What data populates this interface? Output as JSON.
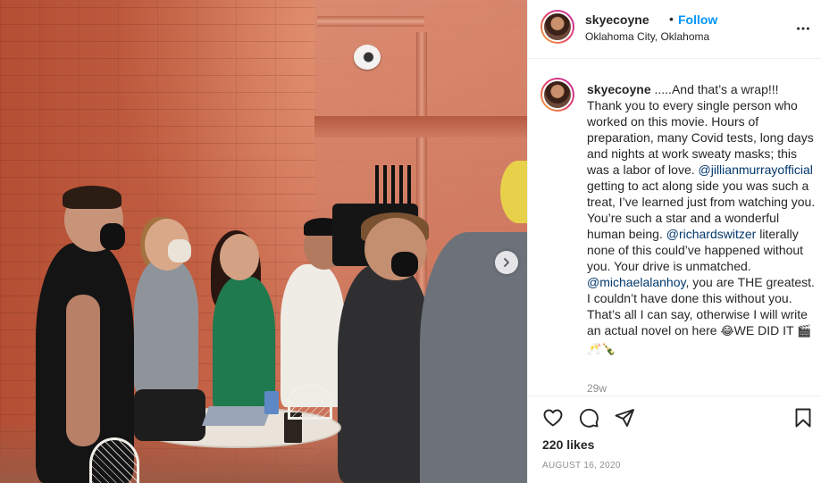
{
  "post": {
    "username": "skyecoyne",
    "follow_separator": "•",
    "follow_label": "Follow",
    "location": "Oklahoma City, Oklahoma",
    "more_icon": "more-horizontal-icon"
  },
  "caption": {
    "username": "skyecoyne",
    "seg1": ".....And that’s a wrap!!! Thank you to every single person who worked on this movie. Hours of preparation, many Covid tests, long days and nights at work sweaty masks; this was a labor of love. ",
    "mention1": "@jillianmurrayofficial",
    "seg2": " getting to act along side you was such a treat, I’ve learned just from watching you. You’re such a star and a wonderful human being. ",
    "mention2": "@richardswitzer",
    "seg3": " literally none of this could’ve happened without you. Your drive is unmatched. ",
    "mention3": "@michaelalanhoy",
    "seg4": ", you are THE greatest. I couldn’t have done this without you. That’s all I can say, otherwise I will write an actual novel on here ",
    "emoji1": "😂",
    "seg5": "WE DID IT ",
    "emoji2": "🎬🥂🍾",
    "age": "29w"
  },
  "actions": {
    "icons": [
      "heart-icon",
      "comment-icon",
      "share-icon",
      "bookmark-icon"
    ],
    "likes": "220 likes",
    "date": "AUGUST 16, 2020"
  },
  "media": {
    "next_icon": "chevron-right-icon"
  },
  "colors": {
    "link_blue": "#0095f6",
    "mention": "#00376b",
    "muted": "#8e8e8e",
    "text": "#262626"
  }
}
